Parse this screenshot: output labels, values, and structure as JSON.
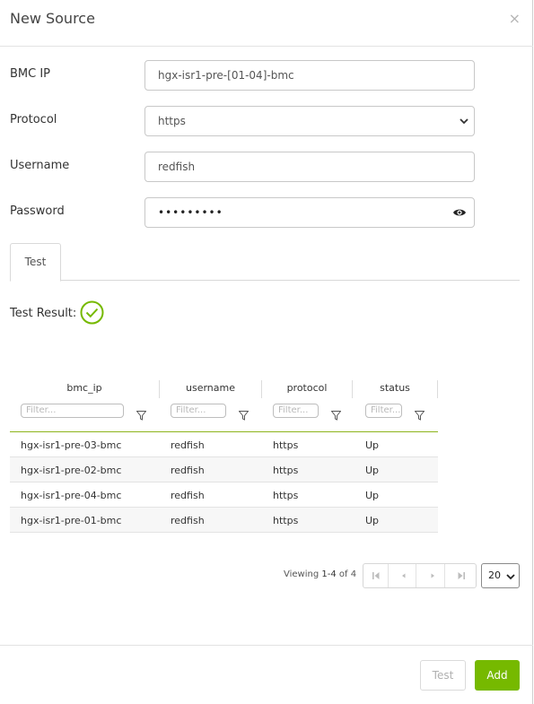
{
  "dialog": {
    "title": "New Source",
    "close_glyph": "×"
  },
  "form": {
    "bmc_ip": {
      "label": "BMC IP",
      "value": "hgx-isr1-pre-[01-04]-bmc"
    },
    "protocol": {
      "label": "Protocol",
      "value": "https"
    },
    "username": {
      "label": "Username",
      "value": "redfish"
    },
    "password": {
      "label": "Password",
      "value": "•••••••••"
    }
  },
  "tabs": [
    {
      "label": "Test",
      "active": true
    }
  ],
  "test_result": {
    "label": "Test Result:",
    "status_icon": "check-circle-icon"
  },
  "grid": {
    "columns": [
      {
        "header": "bmc_ip",
        "filter_placeholder": "Filter..."
      },
      {
        "header": "username",
        "filter_placeholder": "Filter..."
      },
      {
        "header": "protocol",
        "filter_placeholder": "Filter..."
      },
      {
        "header": "status",
        "filter_placeholder": "Filter..."
      }
    ],
    "rows": [
      {
        "bmc_ip": "hgx-isr1-pre-03-bmc",
        "username": "redfish",
        "protocol": "https",
        "status": "Up"
      },
      {
        "bmc_ip": "hgx-isr1-pre-02-bmc",
        "username": "redfish",
        "protocol": "https",
        "status": "Up"
      },
      {
        "bmc_ip": "hgx-isr1-pre-04-bmc",
        "username": "redfish",
        "protocol": "https",
        "status": "Up"
      },
      {
        "bmc_ip": "hgx-isr1-pre-01-bmc",
        "username": "redfish",
        "protocol": "https",
        "status": "Up"
      }
    ]
  },
  "pagination": {
    "viewing_prefix": "Viewing ",
    "range": "1-4",
    "of_text": " of ",
    "total": "4",
    "page_size": "20"
  },
  "footer": {
    "test_label": "Test",
    "add_label": "Add"
  },
  "colors": {
    "accent": "#76b900",
    "grid_header_border": "#8cb31c"
  }
}
